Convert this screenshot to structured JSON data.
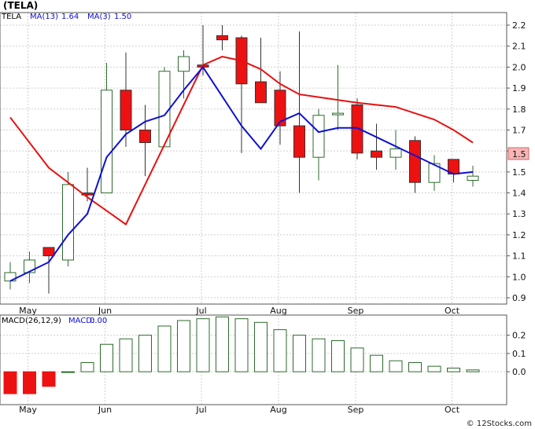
{
  "chart_data": [
    {
      "type": "candlestick",
      "title": "(TELA)",
      "legend": {
        "symbol": "TELA",
        "ma13_label": "MA(13)",
        "ma13_value": "1.64",
        "ma3_label": "MA(3)",
        "ma3_value": "1.50",
        "ma13_color": "#e81010",
        "ma3_color": "#1010d0"
      },
      "last_price_label": "1.5",
      "y_ticks": [
        "2.2",
        "2.1",
        "2.0",
        "1.9",
        "1.8",
        "1.7",
        "1.6",
        "1.5",
        "1.4",
        "1.3",
        "1.2",
        "1.1",
        "1.0",
        "0.9"
      ],
      "ylim": [
        0.87,
        2.26
      ],
      "x_labels": [
        "May",
        "Jun",
        "Jul",
        "Aug",
        "Sep",
        "Oct"
      ],
      "x_label_index": [
        1,
        5,
        10,
        14,
        18,
        23
      ],
      "candles": [
        {
          "o": 0.98,
          "h": 1.07,
          "l": 0.94,
          "c": 1.02
        },
        {
          "o": 1.02,
          "h": 1.12,
          "l": 0.97,
          "c": 1.08
        },
        {
          "o": 1.14,
          "h": 1.14,
          "l": 0.92,
          "c": 1.1
        },
        {
          "o": 1.08,
          "h": 1.5,
          "l": 1.05,
          "c": 1.44
        },
        {
          "o": 1.4,
          "h": 1.52,
          "l": 1.36,
          "c": 1.39
        },
        {
          "o": 1.4,
          "h": 2.02,
          "l": 1.4,
          "c": 1.89
        },
        {
          "o": 1.89,
          "h": 2.07,
          "l": 1.62,
          "c": 1.7
        },
        {
          "o": 1.7,
          "h": 1.82,
          "l": 1.48,
          "c": 1.64
        },
        {
          "o": 1.62,
          "h": 2.0,
          "l": 1.62,
          "c": 1.98
        },
        {
          "o": 1.98,
          "h": 2.08,
          "l": 1.85,
          "c": 2.05
        },
        {
          "o": 2.01,
          "h": 2.2,
          "l": 1.96,
          "c": 2.0
        },
        {
          "o": 2.15,
          "h": 2.2,
          "l": 2.08,
          "c": 2.13
        },
        {
          "o": 2.14,
          "h": 2.15,
          "l": 1.59,
          "c": 1.92
        },
        {
          "o": 1.93,
          "h": 2.14,
          "l": 1.84,
          "c": 1.83
        },
        {
          "o": 1.89,
          "h": 1.98,
          "l": 1.63,
          "c": 1.72
        },
        {
          "o": 1.72,
          "h": 2.17,
          "l": 1.4,
          "c": 1.57
        },
        {
          "o": 1.57,
          "h": 1.8,
          "l": 1.46,
          "c": 1.77
        },
        {
          "o": 1.78,
          "h": 2.01,
          "l": 1.7,
          "c": 1.78
        },
        {
          "o": 1.82,
          "h": 1.85,
          "l": 1.56,
          "c": 1.59
        },
        {
          "o": 1.6,
          "h": 1.73,
          "l": 1.51,
          "c": 1.57
        },
        {
          "o": 1.57,
          "h": 1.7,
          "l": 1.51,
          "c": 1.61
        },
        {
          "o": 1.65,
          "h": 1.67,
          "l": 1.4,
          "c": 1.45
        },
        {
          "o": 1.45,
          "h": 1.58,
          "l": 1.41,
          "c": 1.54
        },
        {
          "o": 1.56,
          "h": 1.56,
          "l": 1.45,
          "c": 1.49
        },
        {
          "o": 1.46,
          "h": 1.53,
          "l": 1.43,
          "c": 1.48
        }
      ],
      "ma13": [
        1.76,
        null,
        1.52,
        null,
        1.38,
        null,
        1.25,
        null,
        null,
        null,
        2.01,
        2.05,
        2.03,
        1.99,
        1.92,
        1.87,
        null,
        null,
        1.83,
        null,
        1.81,
        null,
        1.75,
        1.7,
        1.64
      ],
      "ma3": [
        0.98,
        null,
        1.07,
        1.2,
        1.3,
        1.57,
        1.68,
        1.74,
        1.77,
        1.89,
        2.0,
        null,
        1.72,
        1.61,
        1.74,
        1.78,
        1.69,
        1.71,
        1.71,
        null,
        null,
        null,
        null,
        1.49,
        1.5
      ],
      "grid": true
    },
    {
      "type": "bar",
      "title": "MACD(26,12,9)",
      "legend": {
        "label": "MACD(26,12,9)",
        "macd_label": "MACD:",
        "macd_value": "0.00",
        "macd_color": "#1010d0"
      },
      "y_ticks": [
        "0.2",
        "0.1",
        "0.0"
      ],
      "ylim": [
        -0.18,
        0.31
      ],
      "x_labels": [
        "May",
        "Jun",
        "Jul",
        "Aug",
        "Sep",
        "Oct"
      ],
      "values": [
        -0.12,
        -0.12,
        -0.08,
        0.0,
        0.05,
        0.15,
        0.18,
        0.2,
        0.25,
        0.28,
        0.29,
        0.3,
        0.29,
        0.27,
        0.23,
        0.2,
        0.18,
        0.17,
        0.13,
        0.09,
        0.06,
        0.05,
        0.03,
        0.02,
        0.01
      ],
      "grid": true
    }
  ],
  "watermark": "© 12Stocks.com"
}
